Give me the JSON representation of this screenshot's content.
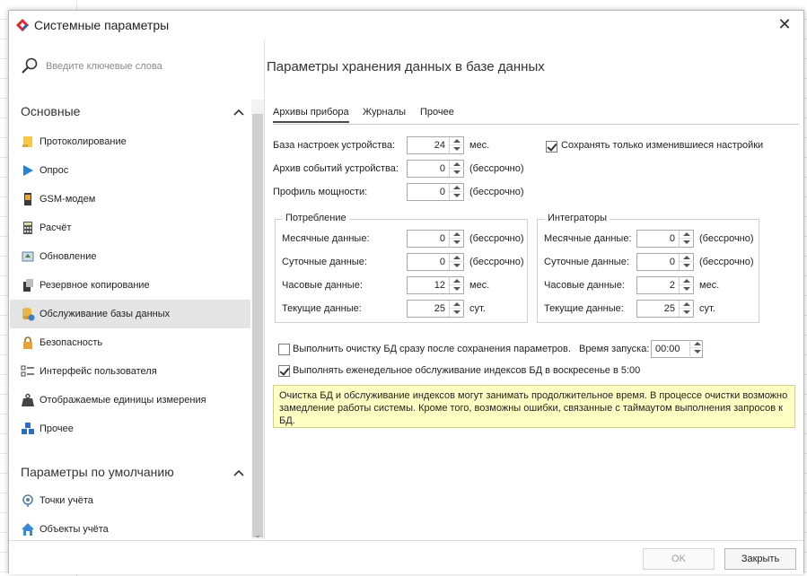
{
  "window": {
    "title": "Системные параметры"
  },
  "search": {
    "placeholder": "Введите ключевые слова"
  },
  "sidebar": {
    "groups": [
      {
        "title": "Основные",
        "items": [
          {
            "label": "Протоколирование",
            "icon": "log-icon"
          },
          {
            "label": "Опрос",
            "icon": "play-icon"
          },
          {
            "label": "GSM-модем",
            "icon": "modem-icon"
          },
          {
            "label": "Расчёт",
            "icon": "calculator-icon"
          },
          {
            "label": "Обновление",
            "icon": "update-icon"
          },
          {
            "label": "Резервное копирование",
            "icon": "backup-icon"
          },
          {
            "label": "Обслуживание базы данных",
            "icon": "database-icon",
            "selected": true
          },
          {
            "label": "Безопасность",
            "icon": "lock-icon"
          },
          {
            "label": "Интерфейс пользователя",
            "icon": "interface-icon"
          },
          {
            "label": "Отображаемые единицы измерения",
            "icon": "weight-icon"
          },
          {
            "label": "Прочее",
            "icon": "cubes-icon"
          }
        ]
      },
      {
        "title": "Параметры по умолчанию",
        "items": [
          {
            "label": "Точки учёта",
            "icon": "point-icon"
          },
          {
            "label": "Объекты учёта",
            "icon": "house-icon"
          }
        ]
      }
    ]
  },
  "content": {
    "title": "Параметры хранения данных в базе данных",
    "tabs": [
      "Архивы прибора",
      "Журналы",
      "Прочее"
    ],
    "device": {
      "settings_db": {
        "label": "База настроек устройства:",
        "value": "24",
        "unit": "мес."
      },
      "events_archive": {
        "label": "Архив событий устройства:",
        "value": "0",
        "unit": "(бессрочно)"
      },
      "power_profile": {
        "label": "Профиль мощности:",
        "value": "0",
        "unit": "(бессрочно)"
      },
      "save_changed_only": {
        "label": "Сохранять только изменившиеся настройки",
        "checked": true
      }
    },
    "consumption": {
      "title": "Потребление",
      "rows": [
        {
          "label": "Месячные данные:",
          "value": "0",
          "unit": "(бессрочно)"
        },
        {
          "label": "Суточные данные:",
          "value": "0",
          "unit": "(бессрочно)"
        },
        {
          "label": "Часовые данные:",
          "value": "12",
          "unit": "мес."
        },
        {
          "label": "Текущие данные:",
          "value": "25",
          "unit": "сут."
        }
      ]
    },
    "integrators": {
      "title": "Интеграторы",
      "rows": [
        {
          "label": "Месячные данные:",
          "value": "0",
          "unit": "(бессрочно)"
        },
        {
          "label": "Суточные данные:",
          "value": "0",
          "unit": "(бессрочно)"
        },
        {
          "label": "Часовые данные:",
          "value": "2",
          "unit": "мес."
        },
        {
          "label": "Текущие данные:",
          "value": "25",
          "unit": "сут."
        }
      ]
    },
    "cleanup": {
      "label": "Выполнить очистку БД сразу после сохранения параметров.",
      "checked": false,
      "start_time_label": "Время запуска:",
      "start_time": "00:00"
    },
    "weekly": {
      "label": "Выполнять еженедельное обслуживание индексов БД в воскресенье в 5:00",
      "checked": true
    },
    "warning": "Очистка БД и обслуживание индексов могут занимать продолжительное время. В процессе очистки возможно замедление работы системы. Кроме того, возможны ошибки, связанные с таймаутом выполнения запросов к БД."
  },
  "footer": {
    "ok": "OK",
    "close": "Закрыть"
  },
  "colors": {
    "selected_item": "#e4e4e4",
    "warning_bg": "#ffffc4",
    "logo_red": "#e0242c"
  }
}
